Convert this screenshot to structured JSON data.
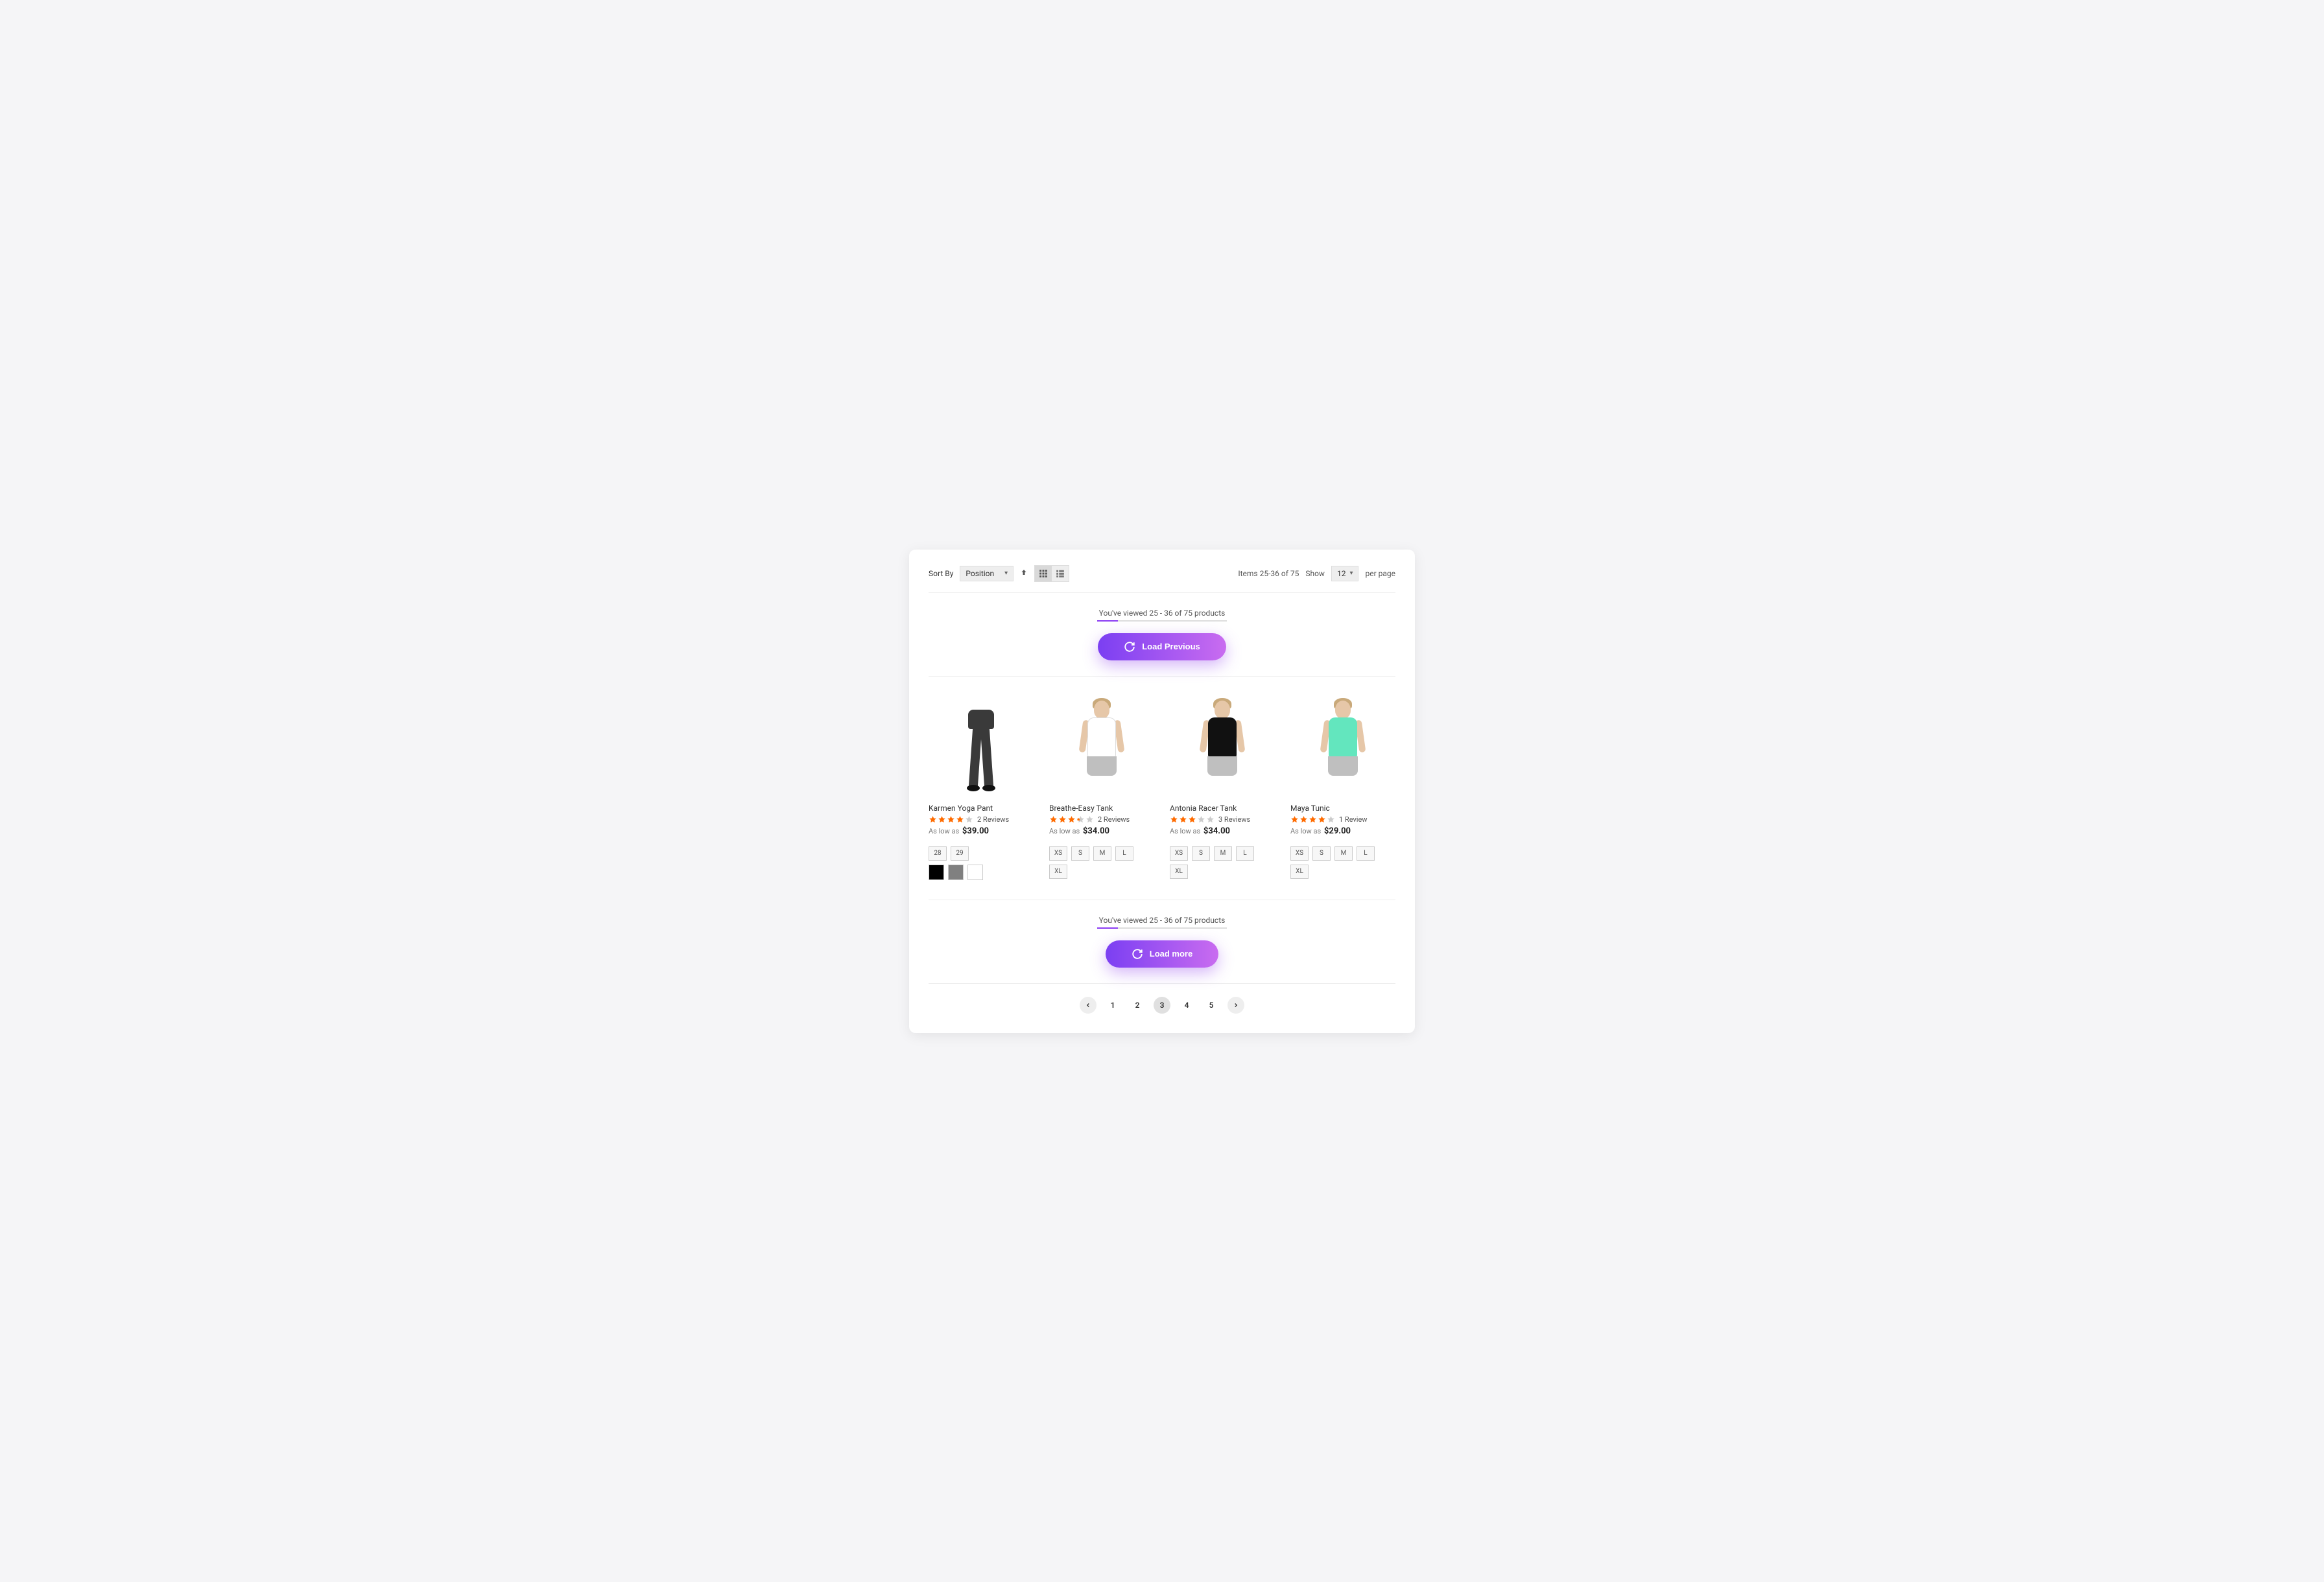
{
  "toolbar": {
    "sort_label": "Sort By",
    "sort_value": "Position",
    "items_text": "Items 25-36 of 75",
    "show_label": "Show",
    "show_value": "12",
    "per_page_label": "per page"
  },
  "viewed": {
    "text": "You've viewed 25 - 36 of 75 products",
    "load_previous": "Load Previous",
    "load_more": "Load more",
    "progress_percent": 16
  },
  "products": [
    {
      "name": "Karmen Yoga Pant",
      "rating": 4,
      "reviews_text": "2 Reviews",
      "as_low_as": "As low as",
      "price": "$39.00",
      "sizes": [
        "28",
        "29"
      ],
      "colors": [
        "#000000",
        "#808080",
        "#ffffff"
      ],
      "variant": "pant"
    },
    {
      "name": "Breathe-Easy Tank",
      "rating": 3.5,
      "reviews_text": "2 Reviews",
      "as_low_as": "As low as",
      "price": "$34.00",
      "sizes": [
        "XS",
        "S",
        "M",
        "L",
        "XL"
      ],
      "colors": [],
      "variant": "tank",
      "tank_color": "#ffffff"
    },
    {
      "name": "Antonia Racer Tank",
      "rating": 3,
      "reviews_text": "3 Reviews",
      "as_low_as": "As low as",
      "price": "$34.00",
      "sizes": [
        "XS",
        "S",
        "M",
        "L",
        "XL"
      ],
      "colors": [],
      "variant": "tank",
      "tank_color": "#111111"
    },
    {
      "name": "Maya Tunic",
      "rating": 4,
      "reviews_text": "1 Review",
      "as_low_as": "As low as",
      "price": "$29.00",
      "sizes": [
        "XS",
        "S",
        "M",
        "L",
        "XL"
      ],
      "colors": [],
      "variant": "tank",
      "tank_color": "#63e6be"
    }
  ],
  "pagination": {
    "pages": [
      "1",
      "2",
      "3",
      "4",
      "5"
    ],
    "active": "3"
  }
}
